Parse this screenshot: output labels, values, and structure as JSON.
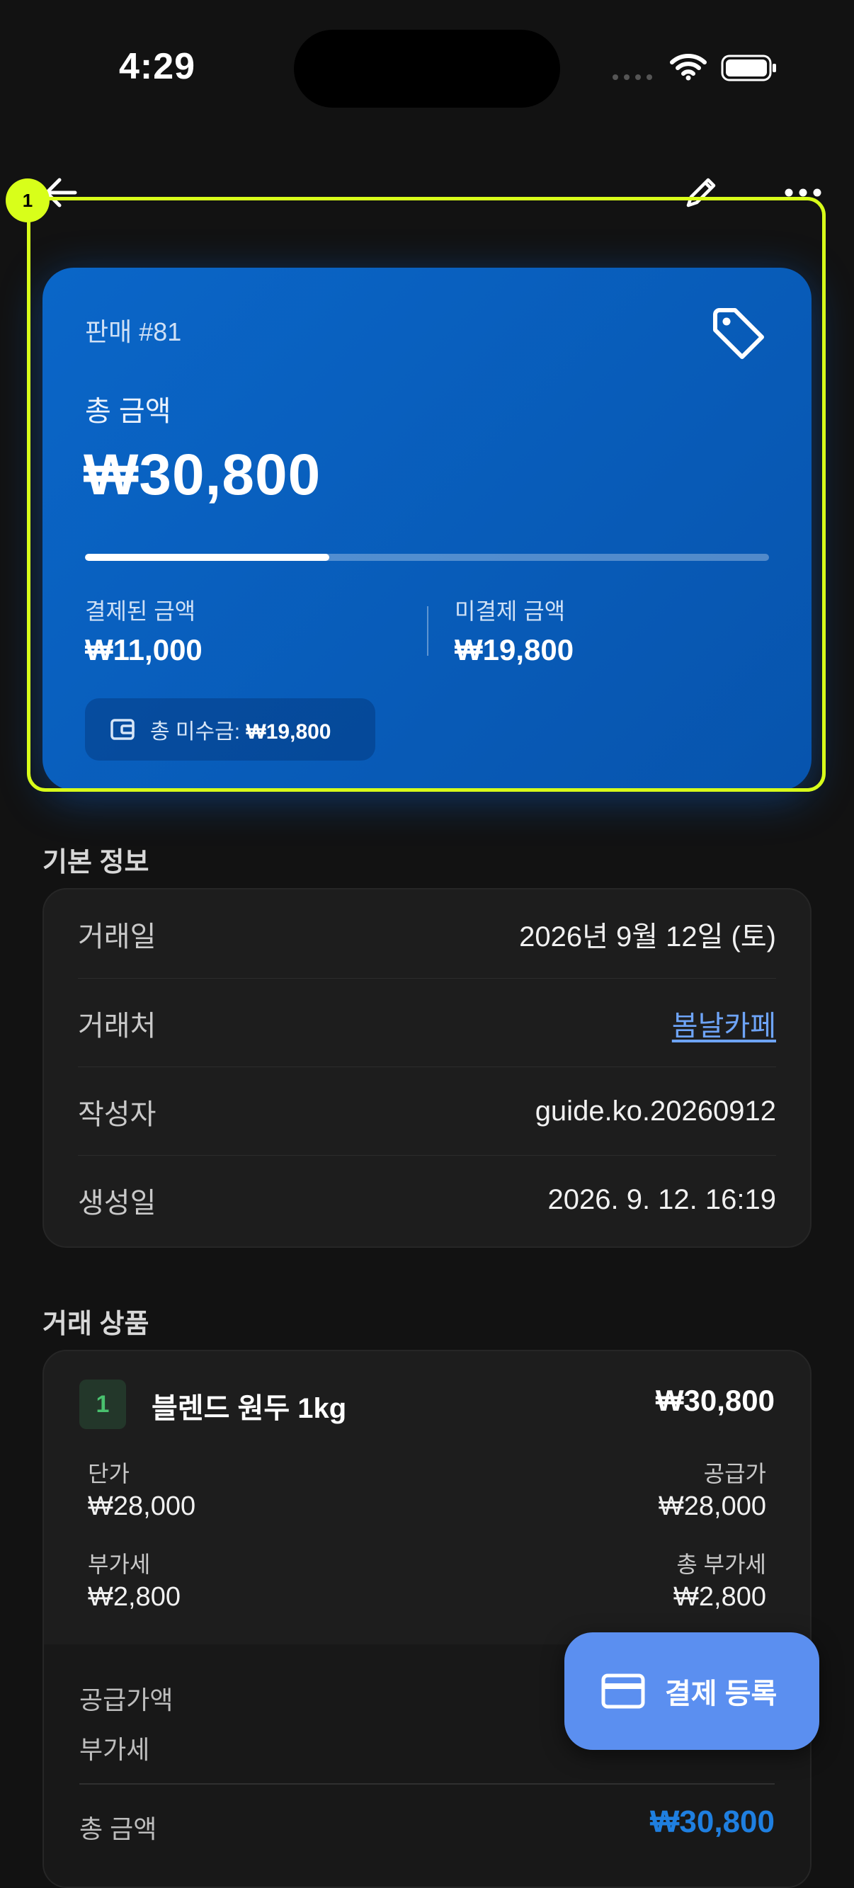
{
  "status_bar": {
    "time": "4:29"
  },
  "summary_card": {
    "sale_number": "판매 #81",
    "total_label": "총 금액",
    "total_amount": "₩30,800",
    "paid_fraction": 0.357,
    "paid_label": "결제된 금액",
    "paid_amount": "₩11,000",
    "unpaid_label": "미결제 금액",
    "unpaid_amount": "₩19,800",
    "receivable_label": "총 미수금:",
    "receivable_amount": "₩19,800"
  },
  "basic_info": {
    "title": "기본 정보",
    "rows": [
      {
        "key": "거래일",
        "value": "2026년 9월 12일 (토)"
      },
      {
        "key": "거래처",
        "value": "봄날카페"
      },
      {
        "key": "작성자",
        "value": "guide.ko.20260912"
      },
      {
        "key": "생성일",
        "value": "2026. 9. 12. 16:19"
      }
    ]
  },
  "items": {
    "title": "거래 상품",
    "list": [
      {
        "index": "1",
        "name": "블렌드 원두 1kg",
        "total": "₩30,800",
        "unit_price_label": "단가",
        "unit_price": "₩28,000",
        "supply_label": "공급가",
        "supply": "₩28,000",
        "vat_label": "부가세",
        "vat": "₩2,800",
        "vat_total_label": "총 부가세",
        "vat_total": "₩2,800"
      }
    ],
    "summary": {
      "supply_label": "공급가액",
      "vat_label": "부가세",
      "total_label": "총 금액",
      "total": "₩30,800"
    }
  },
  "fab": {
    "label": "결제 등록"
  },
  "highlight": {
    "badge": "1"
  },
  "colors": {
    "card_blue": "#0a66c8",
    "fab": "#5b8ff0",
    "link": "#6ea4f7",
    "highlight": "#d8ff1a",
    "accent_total": "#1f7fe0"
  }
}
